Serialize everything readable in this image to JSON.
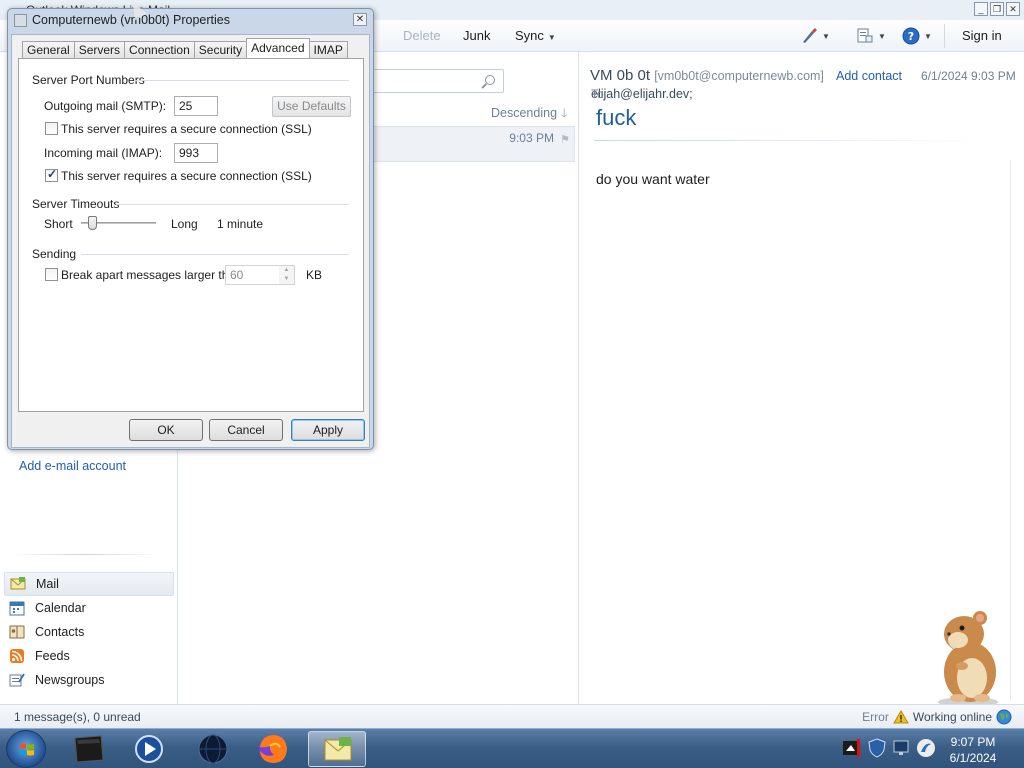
{
  "app": {
    "title": "Outlook Windows Live Mail",
    "toolbar": {
      "delete": "Delete",
      "junk": "Junk",
      "sync": "Sync",
      "signin": "Sign in"
    }
  },
  "leftpane": {
    "add_account": "Add e-mail account",
    "nav": [
      {
        "label": "Mail",
        "icon": "mail-icon"
      },
      {
        "label": "Calendar",
        "icon": "calendar-icon"
      },
      {
        "label": "Contacts",
        "icon": "contacts-icon"
      },
      {
        "label": "Feeds",
        "icon": "feeds-icon"
      },
      {
        "label": "Newsgroups",
        "icon": "newsgroups-icon"
      }
    ]
  },
  "list": {
    "sort": "Descending",
    "message_time": "9:03 PM"
  },
  "reading": {
    "from_name": "VM 0b 0t",
    "from_email": "[vm0b0t@computernewb.com]",
    "add_contact": "Add contact",
    "date": "6/1/2024 9:03 PM",
    "to_label": "To:",
    "to_value": "elijah@elijahr.dev;",
    "subject": "fuck",
    "body": "do you want water"
  },
  "status": {
    "left": "1 message(s), 0 unread",
    "error": "Error",
    "online": "Working online"
  },
  "dialog": {
    "title": "Computernewb (vm0b0t) Properties",
    "tabs": [
      "General",
      "Servers",
      "Connection",
      "Security",
      "Advanced",
      "IMAP"
    ],
    "active_tab": "Advanced",
    "ports_group": "Server Port Numbers",
    "smtp_label": "Outgoing mail (SMTP):",
    "smtp_value": "25",
    "use_defaults": "Use Defaults",
    "smtp_ssl_label": "This server requires a secure connection (SSL)",
    "smtp_ssl_checked": false,
    "imap_label": "Incoming mail (IMAP):",
    "imap_value": "993",
    "imap_ssl_label": "This server requires a secure connection (SSL)",
    "imap_ssl_checked": true,
    "timeouts_group": "Server Timeouts",
    "short_label": "Short",
    "long_label": "Long",
    "timeout_value": "1 minute",
    "timeout_level": 0.1,
    "sending_group": "Sending",
    "break_label": "Break apart messages larger than",
    "break_checked": false,
    "break_value": "60",
    "break_unit": "KB",
    "ok": "OK",
    "cancel": "Cancel",
    "apply": "Apply"
  },
  "taskbar": {
    "time": "9:07 PM",
    "date": "6/1/2024"
  },
  "colors": {
    "link": "#1f5fb0",
    "subject": "#1f5f9c",
    "taskbar": "#3b5e86"
  }
}
